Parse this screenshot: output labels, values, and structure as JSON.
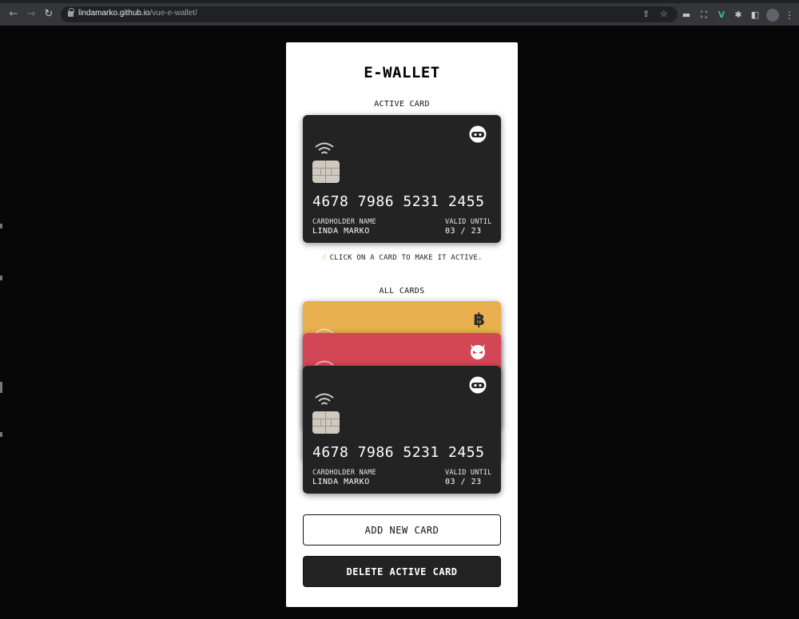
{
  "browser": {
    "url_host": "lindamarko.github.io",
    "url_path": "/vue-e-wallet/"
  },
  "app": {
    "title": "E-WALLET",
    "active_label": "ACTIVE CARD",
    "hint": "CLICK ON A CARD TO MAKE IT ACTIVE.",
    "all_label": "ALL CARDS"
  },
  "active_card": {
    "vendor": "ninja-icon",
    "color": "#232323",
    "number": "4678 7986 5231 2455",
    "holder_label": "CARDHOLDER NAME",
    "holder_name": "LINDA MARKO",
    "valid_label": "VALID UNTIL",
    "valid": "03 / 23"
  },
  "cards": [
    {
      "vendor": "bitcoin-icon",
      "color": "#e9b04f"
    },
    {
      "vendor": "devil-icon",
      "color": "#d34656"
    },
    {
      "vendor": "ninja-icon",
      "color": "#232323",
      "number": "4678 7986 5231 2455",
      "holder_label": "CARDHOLDER NAME",
      "holder_name": "LINDA MARKO",
      "valid_label": "VALID UNTIL",
      "valid": "03 / 23"
    }
  ],
  "icons": {
    "bitcoin": "฿",
    "hand": "☝"
  },
  "buttons": {
    "add": "ADD NEW CARD",
    "delete": "DELETE ACTIVE CARD"
  }
}
